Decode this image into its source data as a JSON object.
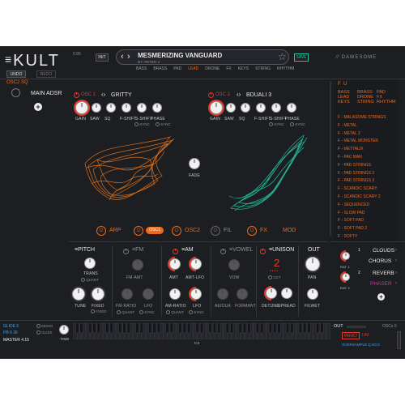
{
  "header": {
    "logo": "KULT",
    "version": "0.95",
    "init_label": "INIT",
    "undo_label": "UNDO",
    "redo_label": "REDO",
    "preset_name": "MESMERIZING VANGUARD",
    "preset_author": "BY:  PETER V",
    "save_label": "SAVE",
    "brand": "DAWESOME",
    "category_tags": [
      "BASS",
      "BRASS",
      "PAD",
      "LEAD",
      "DRONE",
      "FX",
      "KEYS",
      "STRING",
      "RHYTHM"
    ],
    "active_tag": "LEAD"
  },
  "left": {
    "preset_id": "OSC2 SQ",
    "envelope_label": "MAIN ADSR"
  },
  "osc1": {
    "title": "OSC 1",
    "wave_name": "GRITTY",
    "knobs": [
      "GAIN",
      "SAW",
      "SQ",
      "F-SHIFT",
      "S-SHIFT",
      "PHASE"
    ],
    "sync_label": "SYNC",
    "sync2_label": "SYNC"
  },
  "osc2": {
    "title": "OSC 2",
    "wave_name": "BDUALI 3",
    "knobs": [
      "GAIN",
      "SAW",
      "SQ",
      "F-SHIFT",
      "S-SHIFT",
      "PHASE"
    ],
    "sync_label": "SYNC",
    "sync2_label": "SYNC"
  },
  "fade_label": "FADE",
  "routing": {
    "arp": "ARP",
    "osc1": "OSC1",
    "osc2": "OSC2",
    "fil": "FIL",
    "fx": "FX",
    "mod": "MOD"
  },
  "sections": {
    "pitch": {
      "title": "PITCH",
      "trans": "TRANS",
      "quant": "QUANT",
      "tune": "TUNE",
      "fixed": "FIXED",
      "fixed_toggle": "FIXED"
    },
    "fm": {
      "title": "FM",
      "amt": "FM-AMT",
      "ratio": "FM-RATIO",
      "lfo": "LFO",
      "quant": "QUANT",
      "sync": "SYNC"
    },
    "am": {
      "title": "AM",
      "amt": "AMT",
      "amt_lfo": "AMT-LFO",
      "ratio": "AM-RATIO",
      "lfo": "LFO",
      "quant": "QUANT",
      "sync": "SYNC"
    },
    "vowel": {
      "title": "VOWEL",
      "vow": "VOW",
      "aeiou": "AEIOUA",
      "formant": "FORMANT"
    },
    "unison": {
      "title": "UNISON",
      "voices": "2",
      "oct": "OCT",
      "detune": "DETUNE",
      "spread": "SPREAD"
    },
    "out": {
      "title": "OUT",
      "pan": "PAN",
      "filwet": "FILWET"
    }
  },
  "presets": {
    "filter_letters": [
      "F",
      "U"
    ],
    "tags": [
      [
        "BASS",
        "BRASS",
        "PAD"
      ],
      [
        "LEAD",
        "DRONE",
        "FX"
      ],
      [
        "KEYS",
        "STRING",
        "RHYTHM"
      ]
    ],
    "items": [
      "F - MALASOME STRINGS",
      "F - METAL",
      "F - METAL 2",
      "F - METAL MONSTER",
      "F - METTALIX",
      "F - PAC MAN",
      "F - PAD STRINGS",
      "F - PAD STRINGS 2",
      "F - PAD STRINGS 3",
      "F - SCANDIC SCARY",
      "F - SCANDIC SCARY 2",
      "F - SEQUENCED",
      "F - SLOW PAD",
      "F - SOFT PAD",
      "F - SOFT PAD 2",
      "F - SOFTY"
    ]
  },
  "fx": {
    "slots": [
      "CLOUDS",
      "CHORUS",
      "REVERB",
      "PHASER"
    ],
    "rat1": "RAT 1",
    "rat2": "RAT 2",
    "slot_nums": [
      "1",
      "2"
    ]
  },
  "bottom": {
    "glide_label": "GLIDE",
    "glide_val": "6",
    "pb_label": "PB",
    "pb_val": "6  36",
    "master_label": "MASTER",
    "master_val": "4.15",
    "mono": "MONO",
    "gliss": "GLISS",
    "time": "TIME",
    "note": "C3",
    "out": "OUT",
    "panic": "PANIC!",
    "lim": "LIM",
    "oversample": "OVERSAMPLE",
    "oversample_val": "Q",
    "eco": "ECO",
    "oscs_label": "OSCs",
    "oscs_val": "0"
  }
}
